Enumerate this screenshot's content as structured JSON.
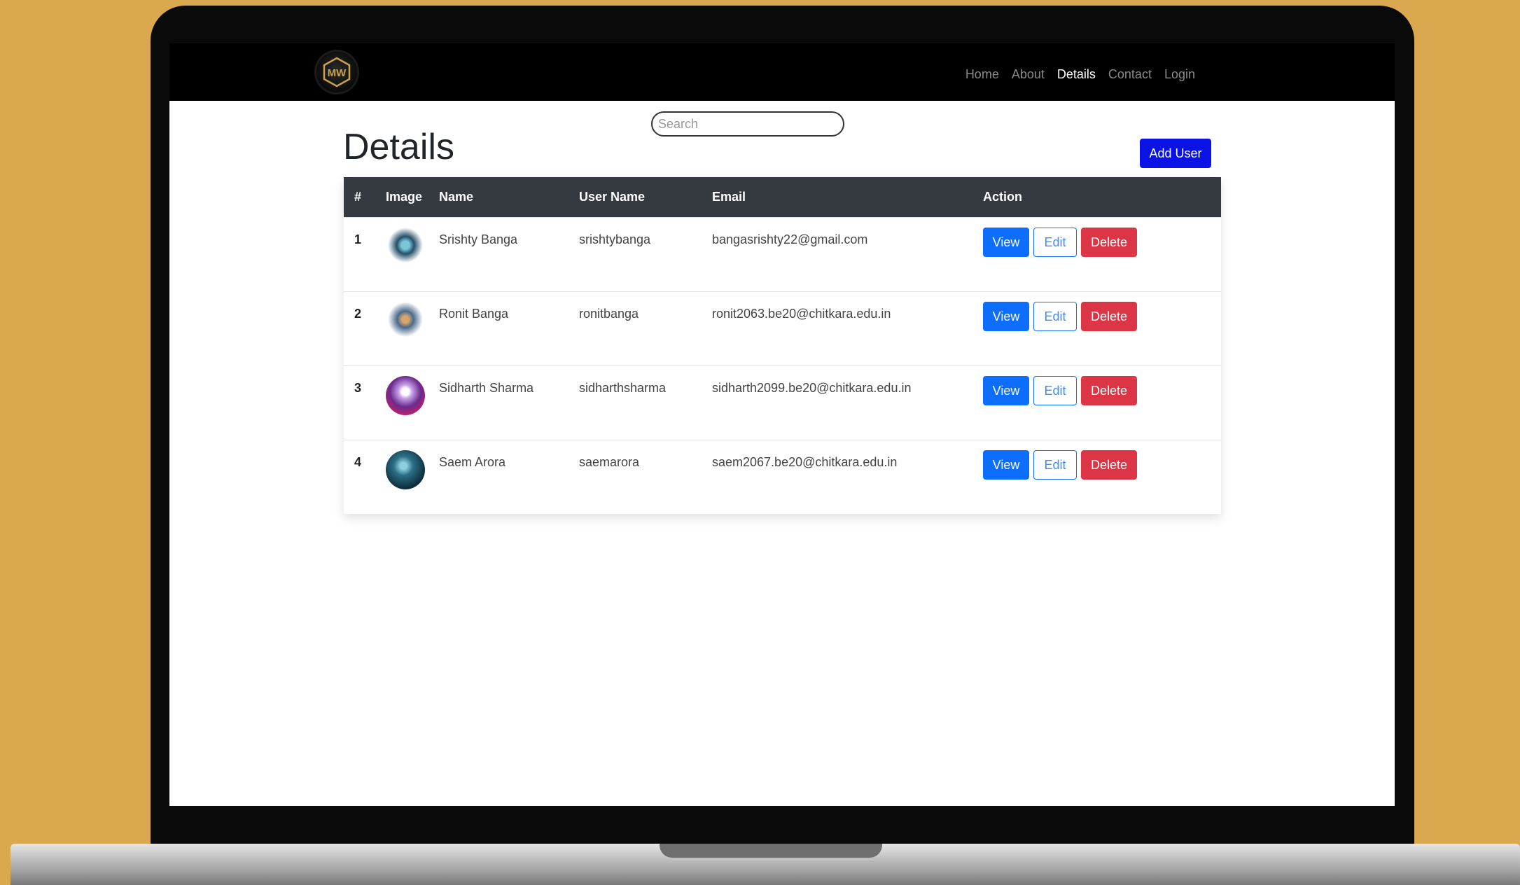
{
  "nav": {
    "logo_text": "MW",
    "links": [
      "Home",
      "About",
      "Details",
      "Contact",
      "Login"
    ],
    "active": "Details"
  },
  "search": {
    "placeholder": "Search"
  },
  "page": {
    "title": "Details",
    "add_label": "Add User"
  },
  "table": {
    "headers": [
      "#",
      "Image",
      "Name",
      "User Name",
      "Email",
      "Action"
    ],
    "rows": [
      {
        "num": "1",
        "name": "Srishty Banga",
        "username": "srishtybanga",
        "email": "bangasrishty22@gmail.com"
      },
      {
        "num": "2",
        "name": "Ronit Banga",
        "username": "ronitbanga",
        "email": "ronit2063.be20@chitkara.edu.in"
      },
      {
        "num": "3",
        "name": "Sidharth Sharma",
        "username": "sidharthsharma",
        "email": "sidharth2099.be20@chitkara.edu.in"
      },
      {
        "num": "4",
        "name": "Saem Arora",
        "username": "saemarora",
        "email": "saem2067.be20@chitkara.edu.in"
      }
    ],
    "actions": {
      "view": "View",
      "edit": "Edit",
      "delete": "Delete"
    }
  },
  "colors": {
    "background": "#d9a84f",
    "navbar": "#000000",
    "add_button": "#0a12e6",
    "view_button": "#0d6efd",
    "delete_button": "#dc3545",
    "table_header": "#343a40"
  }
}
